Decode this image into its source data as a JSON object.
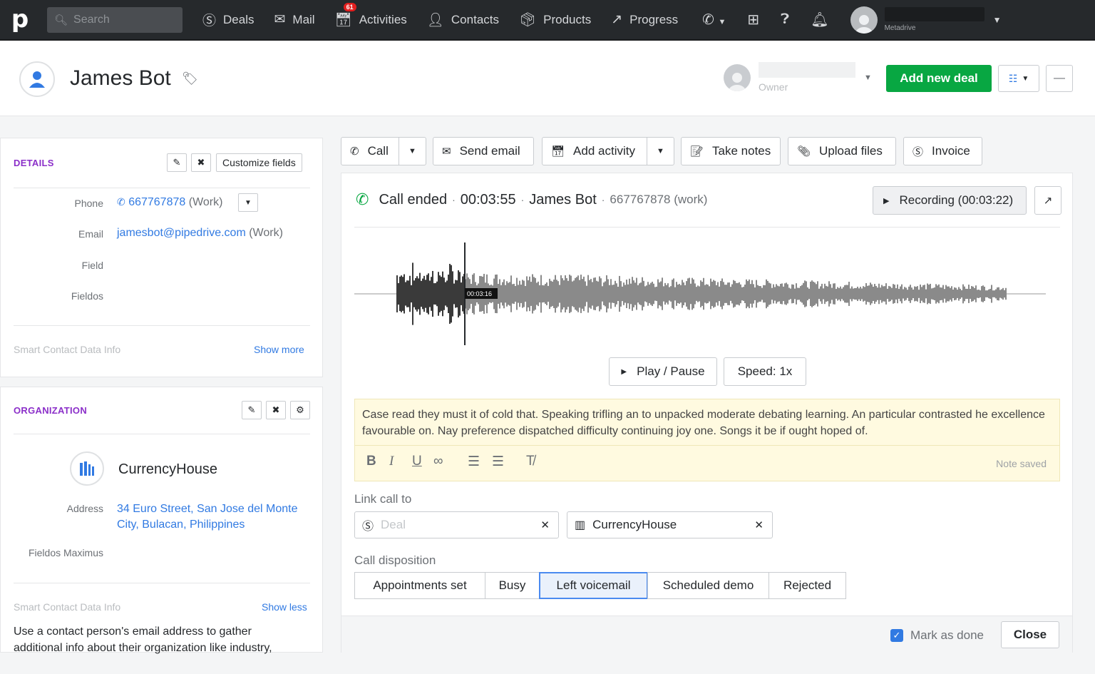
{
  "nav": {
    "search_placeholder": "Search",
    "items": [
      {
        "label": "Deals",
        "icon": "deals-icon"
      },
      {
        "label": "Mail",
        "icon": "mail-icon"
      },
      {
        "label": "Activities",
        "icon": "activities-icon",
        "badge": "61"
      },
      {
        "label": "Contacts",
        "icon": "contacts-icon"
      },
      {
        "label": "Products",
        "icon": "products-icon"
      },
      {
        "label": "Progress",
        "icon": "progress-icon"
      }
    ],
    "company": "Metadrive"
  },
  "header": {
    "person_name": "James Bot",
    "owner_label": "Owner",
    "add_deal_label": "Add new deal"
  },
  "details": {
    "title": "DETAILS",
    "customize_label": "Customize fields",
    "fields": [
      {
        "label": "Phone",
        "value": "667767878",
        "suffix": "(Work)"
      },
      {
        "label": "Email",
        "value": "jamesbot@pipedrive.com",
        "suffix": "(Work)"
      },
      {
        "label": "Field",
        "value": "",
        "suffix": ""
      },
      {
        "label": "Fieldos",
        "value": "",
        "suffix": ""
      }
    ],
    "smart_label": "Smart Contact Data Info",
    "show_more": "Show more"
  },
  "organization": {
    "title": "ORGANIZATION",
    "name": "CurrencyHouse",
    "address_label": "Address",
    "address_line1": "34 Euro Street, San Jose del Monte",
    "address_line2": "City, Bulacan, Philippines",
    "field_label": "Fieldos Maximus",
    "smart_label": "Smart Contact Data Info",
    "show_less": "Show less",
    "info_line1": "Use a contact person's email address to gather",
    "info_line2": "additional info about their organization like industry,"
  },
  "actions": {
    "call": "Call",
    "send_email": "Send email",
    "add_activity": "Add activity",
    "take_notes": "Take notes",
    "upload_files": "Upload files",
    "invoice": "Invoice"
  },
  "call": {
    "status": "Call ended",
    "duration": "00:03:55",
    "person": "James Bot",
    "number": "667767878 (work)",
    "recording_label": "Recording (00:03:22)",
    "playhead_time": "00:03:16",
    "playhead_fraction": 0.153,
    "play_pause": "Play / Pause",
    "speed": "Speed: 1x",
    "note_text": "Case read they must it of cold that. Speaking trifling an to unpacked moderate debating learning. An particular contrasted he excellence favourable on. Nay preference dispatched difficulty continuing joy one. Songs it be if ought hoped of.",
    "note_saved": "Note saved",
    "link_label": "Link call to",
    "deal_placeholder": "Deal",
    "org_value": "CurrencyHouse",
    "disposition_label": "Call disposition",
    "dispositions": [
      "Appointments set",
      "Busy",
      "Left voicemail",
      "Scheduled demo",
      "Rejected"
    ],
    "selected_disposition": "Left voicemail",
    "mark_done": "Mark as done",
    "close": "Close"
  },
  "colors": {
    "accent": "#317ae2",
    "primary_button": "#08a742",
    "section_title": "#8b2fc9",
    "nav_bg": "#26292c",
    "note_bg": "#fffae0"
  }
}
